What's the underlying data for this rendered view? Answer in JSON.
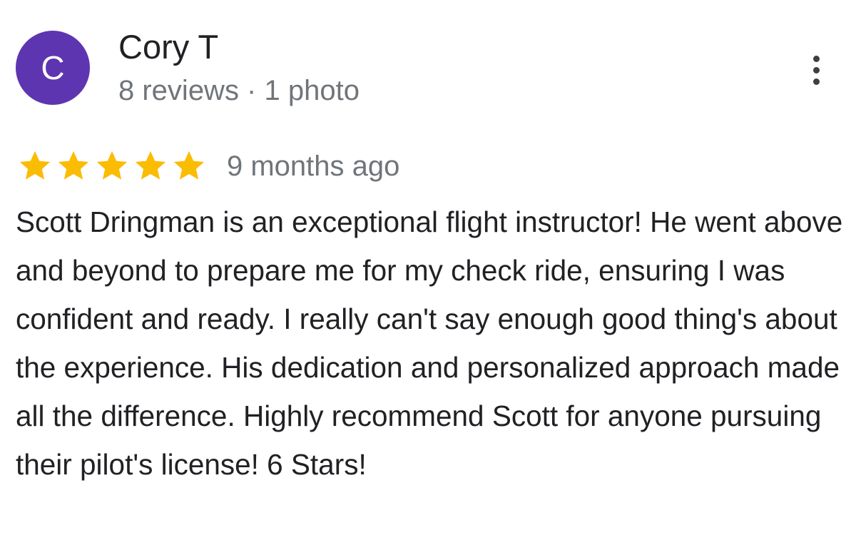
{
  "reviewer": {
    "avatar_letter": "C",
    "avatar_color": "#5e35b1",
    "name": "Cory T",
    "meta": "8 reviews · 1 photo"
  },
  "menu": {
    "icon": "more-vert-icon"
  },
  "rating": {
    "stars": 5,
    "max_stars": 5,
    "star_color": "#fbbc04",
    "date": "9 months ago"
  },
  "review": {
    "text": "Scott Dringman is an exceptional flight instructor! He went above and beyond to prepare me for my check ride, ensuring I was confident and ready. I really can't say enough good thing's about the experience. His dedication and personalized approach made all the difference. Highly recommend Scott for anyone pursuing their pilot's license! 6 Stars!"
  }
}
